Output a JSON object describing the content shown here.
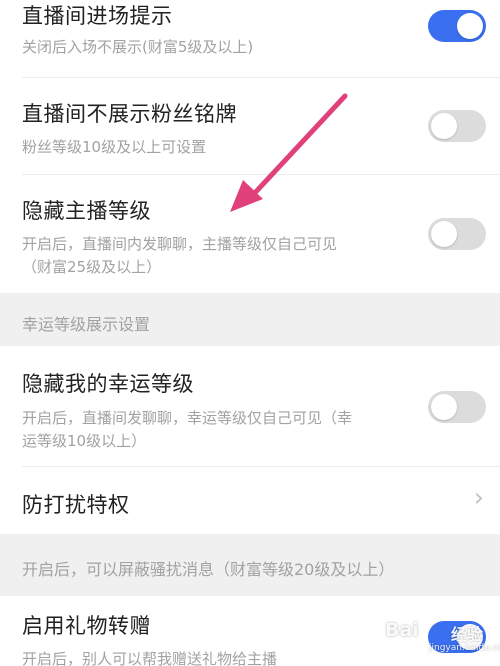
{
  "settings": {
    "entry_notice": {
      "title": "直播间进场提示",
      "desc": "关闭后入场不展示(财富5级及以上)",
      "toggle_state": "on"
    },
    "hide_fan_badge": {
      "title": "直播间不展示粉丝铭牌",
      "desc": "粉丝等级10级及以上可设置",
      "toggle_state": "off"
    },
    "hide_host_level": {
      "title": "隐藏主播等级",
      "desc_line1": "开启后，直播间内发聊聊，主播等级仅自己可见",
      "desc_line2": "（财富25级及以上）",
      "toggle_state": "off"
    }
  },
  "lucky_section": {
    "header": "幸运等级展示设置",
    "hide_lucky_level": {
      "title": "隐藏我的幸运等级",
      "desc_line1": "开启后，直播间发聊聊，幸运等级仅自己可见（幸",
      "desc_line2": "运等级10级以上）",
      "toggle_state": "off"
    },
    "anti_disturb": {
      "title": "防打扰特权",
      "chevron": "›"
    }
  },
  "anti_disturb_footer": {
    "text": "开启后，可以屏蔽骚扰消息（财富等级20级及以上）"
  },
  "gift_transfer": {
    "title": "启用礼物转赠",
    "desc": "开启后，别人可以帮我赠送礼物给主播",
    "toggle_state": "on"
  },
  "watermark": {
    "brand": "Bai",
    "sub": "经验",
    "url": "jingyan.baidu.com"
  },
  "colors": {
    "toggle_on": "#3a6ff0",
    "toggle_off": "#dcdcdc",
    "annotation_arrow": "#e0417a",
    "section_bg": "#f0f0f0"
  },
  "icons": {
    "annotation": "pink-arrow-icon",
    "chevron": "chevron-right-icon"
  }
}
